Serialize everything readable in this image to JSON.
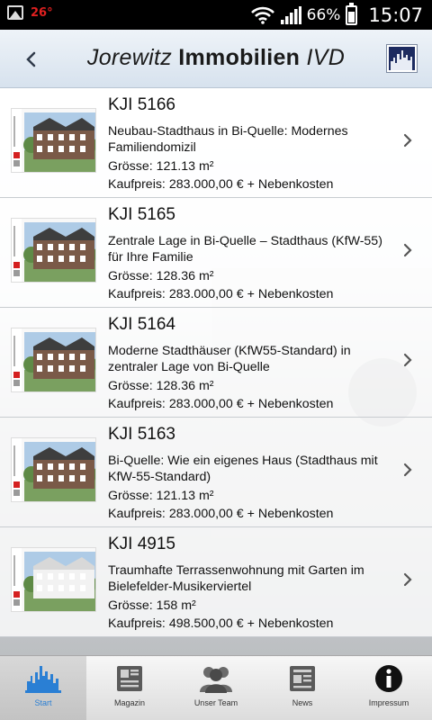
{
  "status_bar": {
    "temperature": "26°",
    "battery_percent": "66%",
    "battery_level": 0.66,
    "time": "15:07"
  },
  "header": {
    "title_part1": "Jorewitz",
    "title_part2": "Immobilien",
    "title_part3": "IVD",
    "back_icon": "chevron-left-icon",
    "logo_icon": "city-skyline-logo"
  },
  "listings": [
    {
      "id": "KJI 5166",
      "title": "Neubau-Stadthaus in Bi-Quelle: Modernes Familiendomizil",
      "size": "Grösse: 121.13 m²",
      "price": "Kaufpreis: 283.000,00 € + Nebenkosten"
    },
    {
      "id": "KJI 5165",
      "title": "Zentrale Lage in Bi-Quelle – Stadthaus (KfW-55) für Ihre Familie",
      "size": "Grösse: 128.36 m²",
      "price": "Kaufpreis: 283.000,00 € + Nebenkosten"
    },
    {
      "id": "KJI 5164",
      "title": "Moderne Stadthäuser (KfW55-Standard) in zentraler Lage von Bi-Quelle",
      "size": "Grösse: 128.36 m²",
      "price": "Kaufpreis: 283.000,00 € + Nebenkosten"
    },
    {
      "id": "KJI 5163",
      "title": "Bi-Quelle: Wie ein eigenes Haus (Stadthaus mit KfW-55-Standard)",
      "size": "Grösse: 121.13 m²",
      "price": "Kaufpreis: 283.000,00 € + Nebenkosten"
    },
    {
      "id": "KJI 4915",
      "title": "Traumhafte Terrassenwohnung mit Garten im Bielefelder-Musikerviertel",
      "size": "Grösse: 158 m²",
      "price": "Kaufpreis: 498.500,00 € + Nebenkosten"
    }
  ],
  "tabs": [
    {
      "label": "Start",
      "icon": "skyline-icon",
      "active": true
    },
    {
      "label": "Magazin",
      "icon": "newspaper-icon",
      "active": false
    },
    {
      "label": "Unser Team",
      "icon": "team-icon",
      "active": false
    },
    {
      "label": "News",
      "icon": "news-icon",
      "active": false
    },
    {
      "label": "Impressum",
      "icon": "info-icon",
      "active": false
    }
  ],
  "colors": {
    "active_tab": "#2a7fd4",
    "status_bar": "#000000",
    "header_top": "#eef3f8",
    "temperature": "#e02020"
  }
}
